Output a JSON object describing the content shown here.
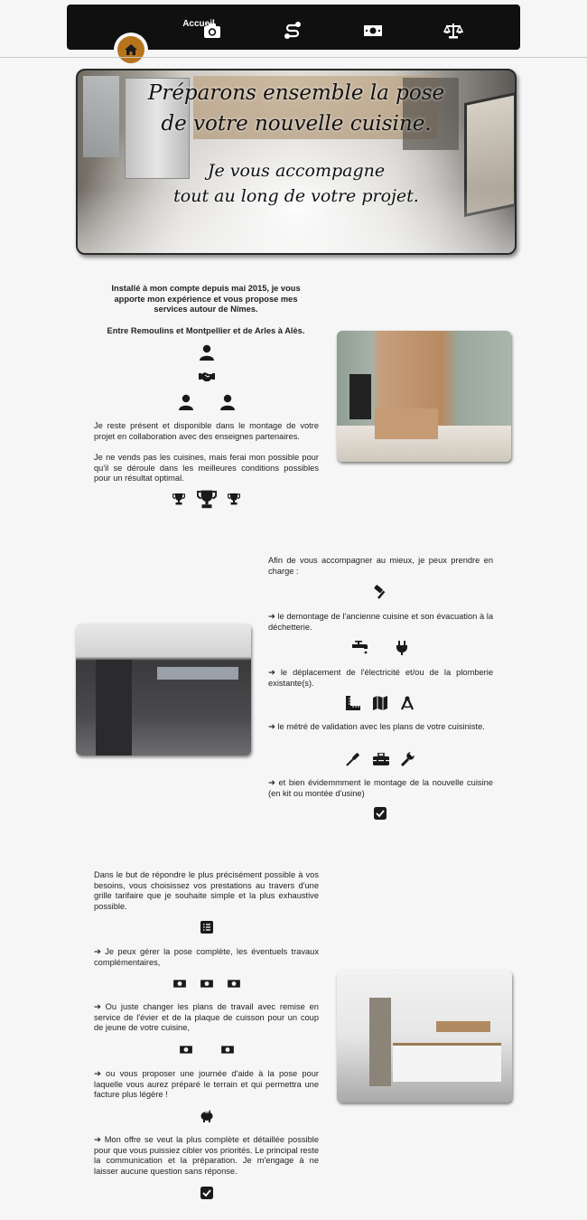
{
  "nav": {
    "home_label": "Accueil",
    "items": [
      {
        "icon": "home-icon",
        "active": true
      },
      {
        "icon": "camera-icon"
      },
      {
        "icon": "route-icon"
      },
      {
        "icon": "money-bill-icon"
      },
      {
        "icon": "scale-balance-icon"
      }
    ],
    "accent_color": "#b8741c"
  },
  "hero": {
    "line1": "Préparons ensemble la pose",
    "line2": "de votre nouvelle cuisine.",
    "line3": "Je vous accompagne",
    "line4": "tout au long de votre projet."
  },
  "section1": {
    "intro": "Installé à mon compte depuis mai 2015, je vous apporte mon expérience et vous propose mes services autour de Nîmes.",
    "area": "Entre Remoulins et Montpellier et de Arles à Alès.",
    "p1": "Je reste présent et disponible dans le montage de votre projet en collaboration avec des enseignes partenaires.",
    "p2": "Je ne vends pas les cuisines, mais ferai mon possible pour qu'il se déroule dans les meilleures conditions possibles pour un résultat optimal."
  },
  "section2": {
    "intro": "Afin de vous accompagner au mieux, je peux prendre en charge :",
    "items": [
      "le demontage de l'ancienne cuisine et son évacuation à la déchetterie.",
      "le déplacement de l'électricité et/ou de la plomberie existante(s).",
      "le métré de validation avec les plans de votre cuisiniste.",
      "et bien évidemmment le montage de la nouvelle cuisine (en kit ou montée d'usine)"
    ]
  },
  "section3": {
    "intro": "Dans le but de répondre le plus précisément possible à vos besoins, vous choisissez vos prestations au travers d'une grille tarifaire que je souhaite simple et la plus exhaustive possible.",
    "items": [
      "Je peux gérer la pose complète, les éventuels travaux complémentaires,",
      "Ou juste changer les plans de travail avec remise en service de l'évier et de la plaque de cuisson pour un coup de jeune de votre cuisine,",
      "ou vous proposer une journée d'aide à la pose pour laquelle vous aurez préparé le terrain et qui permettra une facture plus légère !",
      "Mon offre se veut la plus complète et détaillée possible pour que vous puissiez cibler vos priorités. Le principal reste la communication et la préparation. Je m'engage à ne laisser aucune question sans réponse."
    ]
  }
}
